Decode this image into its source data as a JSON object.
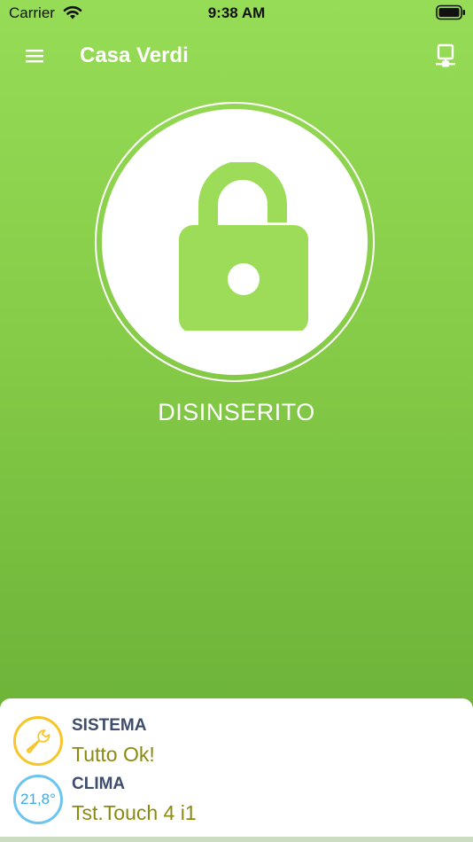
{
  "status_bar": {
    "carrier": "Carrier",
    "time": "9:38 AM",
    "icons": [
      "wifi-icon",
      "battery-icon"
    ]
  },
  "nav": {
    "title": "Casa Verdi",
    "left_icon": "menu-icon",
    "right_icon": "device-icon"
  },
  "alarm": {
    "icon": "unlocked-padlock-icon",
    "state_label": "DISINSERITO",
    "accent_color": "#9ddc58"
  },
  "status_panel": {
    "items": [
      {
        "label": "SISTEMA",
        "value": "Tutto Ok!",
        "icon": "wrench-icon",
        "badge_color": "#f6c529"
      },
      {
        "label": "CLIMA",
        "value": "Tst.Touch 4 i1",
        "badge_text": "21,8°",
        "badge_color": "#6cc5ef"
      }
    ]
  },
  "colors": {
    "background_top": "#97dc56",
    "background_bottom": "#66ad36",
    "label_color": "#3d4d6b",
    "value_color": "#8a8a10"
  }
}
